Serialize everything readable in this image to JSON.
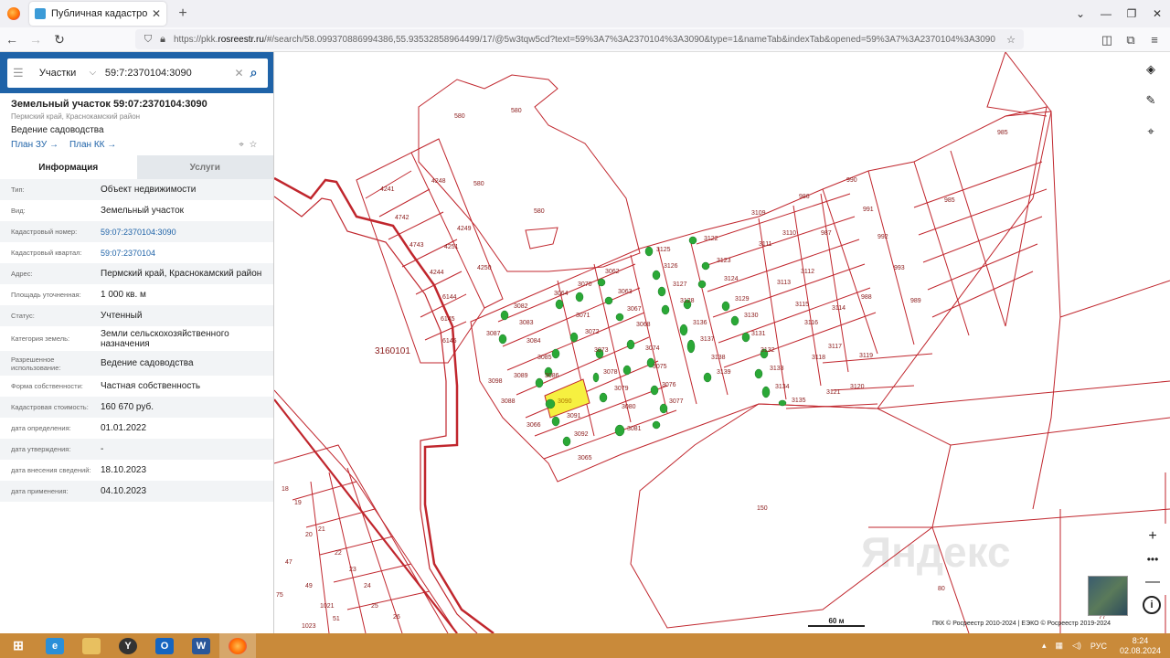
{
  "browser": {
    "tab_title": "Публичная кадастровая карта",
    "url_prefix": "https://pkk.",
    "url_host": "rosreestr.ru",
    "url_rest": "/#/search/58.099370886994386,55.93532858964499/17/@5w3tqw5cd?text=59%3A7%3A2370104%3A3090&type=1&nameTab&indexTab&opened=59%3A7%3A2370104%3A3090"
  },
  "search": {
    "type_label": "Участки",
    "query": "59:7:2370104:3090"
  },
  "parcel": {
    "title": "Земельный участок 59:07:2370104:3090",
    "region": "Пермский край, Краснокамский район",
    "use": "Ведение садоводства",
    "plan_zu": "План ЗУ",
    "plan_kk": "План КК"
  },
  "tabs": {
    "info": "Информация",
    "services": "Услуги"
  },
  "rows": [
    {
      "label": "Тип:",
      "value": "Объект недвижимости"
    },
    {
      "label": "Вид:",
      "value": "Земельный участок"
    },
    {
      "label": "Кадастровый номер:",
      "value": "59:07:2370104:3090"
    },
    {
      "label": "Кадастровый квартал:",
      "value": "59:07:2370104"
    },
    {
      "label": "Адрес:",
      "value": "Пермский край, Краснокамский район"
    },
    {
      "label": "Площадь уточненная:",
      "value": "1 000 кв. м"
    },
    {
      "label": "Статус:",
      "value": "Учтенный"
    },
    {
      "label": "Категория земель:",
      "value": "Земли сельскохозяйственного назначения"
    },
    {
      "label": "Разрешенное использование:",
      "value": "Ведение садоводства"
    },
    {
      "label": "Форма собственности:",
      "value": "Частная собственность"
    },
    {
      "label": "Кадастровая стоимость:",
      "value": "160 670 руб."
    },
    {
      "label": "дата определения:",
      "value": "01.01.2022"
    },
    {
      "label": "дата утверждения:",
      "value": "-"
    },
    {
      "label": "дата внесения сведений:",
      "value": "18.10.2023"
    },
    {
      "label": "дата применения:",
      "value": "04.10.2023"
    }
  ],
  "map": {
    "quarter_label": "3160101",
    "scale": "60 м",
    "copyright": "ПКК © Росреестр 2010-2024 | ЕЭКО © Росреестр 2019-2024",
    "watermark": "Яндекс",
    "labels": {
      "l580a": "580",
      "l580b": "580",
      "l580c": "580",
      "l580d": "580",
      "l985a": "985",
      "l985b": "985",
      "l4241": "4241",
      "l4248": "4248",
      "l4742": "4742",
      "l4249": "4249",
      "l4743": "4743",
      "l4251": "4251",
      "l4244": "4244",
      "l4250": "4250",
      "l6144": "6144",
      "l6145": "6145",
      "l6146": "6146",
      "l3062": "3062",
      "l3063": "3063",
      "l3067": "3067",
      "l3068": "3068",
      "l3071": "3071",
      "l3072": "3072",
      "l3073": "3073",
      "l3070": "3070",
      "l3064": "3064",
      "l3082": "3082",
      "l3083": "3083",
      "l3084": "3084",
      "l3085": "3085",
      "l3086": "3086",
      "l3087": "3087",
      "l3089": "3089",
      "l3088": "3088",
      "l3098": "3098",
      "l3090": "3090",
      "l3091": "3091",
      "l3092": "3092",
      "l3066": "3066",
      "l3065": "3065",
      "l3078": "3078",
      "l3079": "3079",
      "l3080": "3080",
      "l3081": "3081",
      "l3074": "3074",
      "l3075": "3075",
      "l3076": "3076",
      "l3077": "3077",
      "l3125": "3125",
      "l3122": "3122",
      "l3126": "3126",
      "l3123": "3123",
      "l3127": "3127",
      "l3124": "3124",
      "l3128": "3128",
      "l3129": "3129",
      "l3130": "3130",
      "l3131": "3131",
      "l3132": "3132",
      "l3133": "3133",
      "l3134": "3134",
      "l3135": "3135",
      "l3136": "3136",
      "l3137": "3137",
      "l3138": "3138",
      "l3139": "3139",
      "l3109": "3109",
      "l3111": "3111",
      "l3110": "3110",
      "l3112": "3112",
      "l3113": "3113",
      "l3115": "3115",
      "l3116": "3116",
      "l3114": "3114",
      "l3117": "3117",
      "l3118": "3118",
      "l3119": "3119",
      "l3120": "3120",
      "l3121": "3121",
      "l986": "986",
      "l990": "990",
      "l987": "987",
      "l991": "991",
      "l992": "992",
      "l993": "993",
      "l988": "988",
      "l989": "989",
      "l150": "150",
      "l80": "80",
      "l77": "77",
      "l18": "18",
      "l19": "19",
      "l20": "20",
      "l21": "21",
      "l22": "22",
      "l23": "23",
      "l24": "24",
      "l25": "25",
      "l26": "26",
      "l47": "47",
      "l49": "49",
      "l1021": "1021",
      "l51": "51",
      "l75": "75",
      "l1023": "1023"
    }
  },
  "taskbar": {
    "lang": "РУС",
    "time": "8:24",
    "date": "02.08.2024"
  },
  "colors": {
    "accent": "#1f63a8",
    "boundary": "#c0262d",
    "selected": "#f6f040",
    "marker": "#2aa836"
  }
}
